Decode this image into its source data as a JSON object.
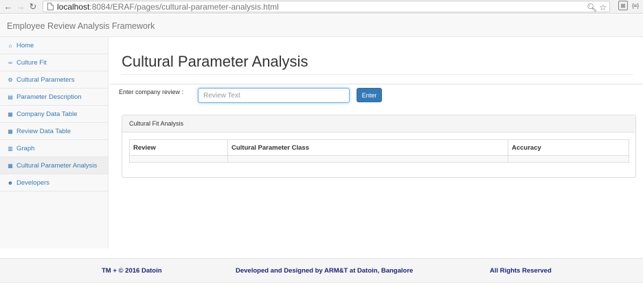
{
  "browser": {
    "url_host": "localhost",
    "url_path": ":8084/ERAF/pages/cultural-parameter-analysis.html",
    "ext1": "⊠",
    "ext2": "{≡}"
  },
  "navbar": {
    "brand": "Employee Review Analysis Framework"
  },
  "sidebar": {
    "items": [
      {
        "label": "Home",
        "icon": "home-icon",
        "glyph": "⌂"
      },
      {
        "label": "Culture Fit",
        "icon": "binoculars-icon",
        "glyph": "∞"
      },
      {
        "label": "Cultural Parameters",
        "icon": "gears-icon",
        "glyph": "⚙"
      },
      {
        "label": "Parameter Description",
        "icon": "file-icon",
        "glyph": "▤"
      },
      {
        "label": "Company Data Table",
        "icon": "table-icon",
        "glyph": "▦"
      },
      {
        "label": "Review Data Table",
        "icon": "table-icon",
        "glyph": "▦"
      },
      {
        "label": "Graph",
        "icon": "bar-chart-icon",
        "glyph": "▥"
      },
      {
        "label": "Cultural Parameter Analysis",
        "icon": "table-icon",
        "glyph": "▦"
      },
      {
        "label": "Developers",
        "icon": "users-icon",
        "glyph": "☻"
      }
    ],
    "active_index": 7
  },
  "main": {
    "title": "Cultural Parameter Analysis",
    "review_label": "Enter company review :",
    "review_placeholder": "Review Text",
    "enter_label": "Enter",
    "panel_heading": "Cultural Fit Analysis",
    "table": {
      "columns": [
        "Review",
        "Cultural Parameter Class",
        "Accuracy"
      ],
      "rows": [
        [
          "",
          "",
          ""
        ]
      ]
    }
  },
  "footer": {
    "left": "TM + © 2016 Datoin",
    "center": "Developed and Designed by ARM&T at Datoin, Bangalore",
    "right": "All Rights Reserved"
  },
  "colors": {
    "accent": "#337ab7",
    "footer_text": "#1a237e"
  }
}
